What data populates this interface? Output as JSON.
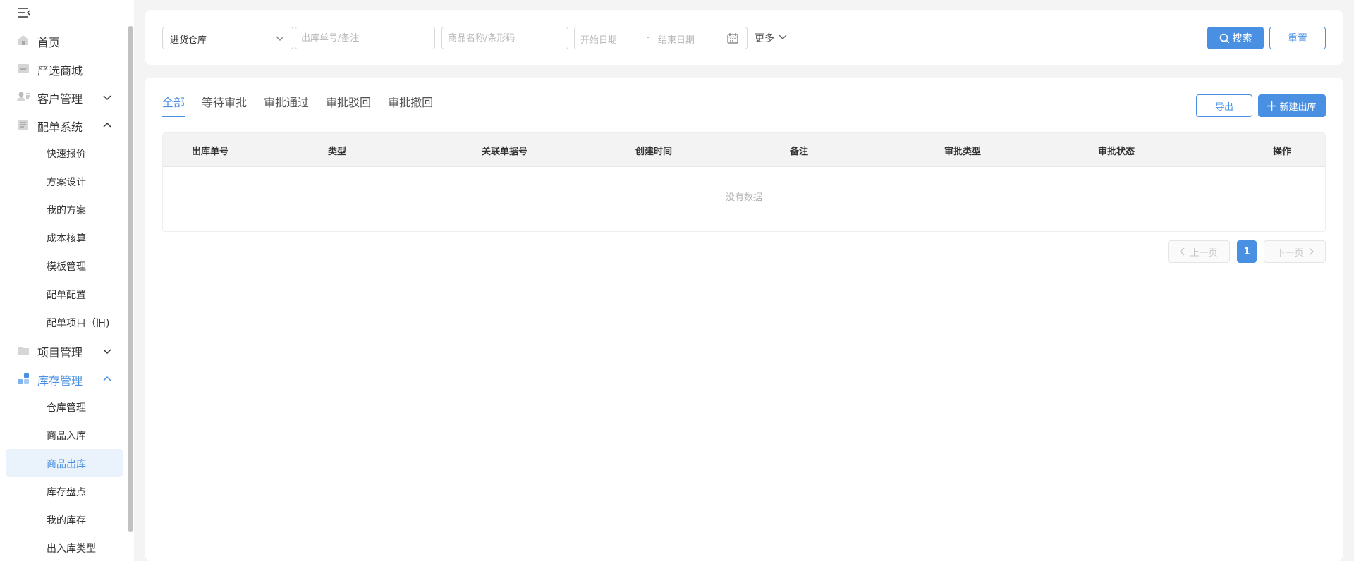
{
  "sidebar": {
    "items": [
      {
        "label": "首页",
        "icon": "home-icon"
      },
      {
        "label": "严选商城",
        "icon": "mall-icon"
      },
      {
        "label": "客户管理",
        "icon": "customer-icon",
        "expanded": false
      },
      {
        "label": "配单系统",
        "icon": "document-icon",
        "expanded": true
      },
      {
        "label": "项目管理",
        "icon": "folder-icon",
        "expanded": false
      },
      {
        "label": "库存管理",
        "icon": "inventory-icon",
        "expanded": true
      }
    ],
    "order_sub": [
      "快速报价",
      "方案设计",
      "我的方案",
      "成本核算",
      "模板管理",
      "配单配置",
      "配单项目（旧)"
    ],
    "inventory_sub": [
      "仓库管理",
      "商品入库",
      "商品出库",
      "库存盘点",
      "我的库存",
      "出入库类型"
    ],
    "active_sub": "商品出库"
  },
  "search": {
    "warehouse_value": "进货仓库",
    "order_placeholder": "出库单号/备注",
    "goods_placeholder": "商品名称/条形码",
    "start_date_placeholder": "开始日期",
    "date_separator": "-",
    "end_date_placeholder": "结束日期",
    "more_label": "更多",
    "search_label": "搜索",
    "reset_label": "重置"
  },
  "tabs": [
    "全部",
    "等待审批",
    "审批通过",
    "审批驳回",
    "审批撤回"
  ],
  "actions": {
    "export_label": "导出",
    "new_label": "新建出库"
  },
  "table": {
    "columns": [
      "出库单号",
      "类型",
      "关联单据号",
      "创建时间",
      "备注",
      "审批类型",
      "审批状态",
      "操作"
    ],
    "empty_text": "没有数据"
  },
  "pagination": {
    "prev_label": "上一页",
    "current_page": "1",
    "next_label": "下一页"
  },
  "colors": {
    "accent": "#4a90e2",
    "background": "#f4f4f4"
  }
}
